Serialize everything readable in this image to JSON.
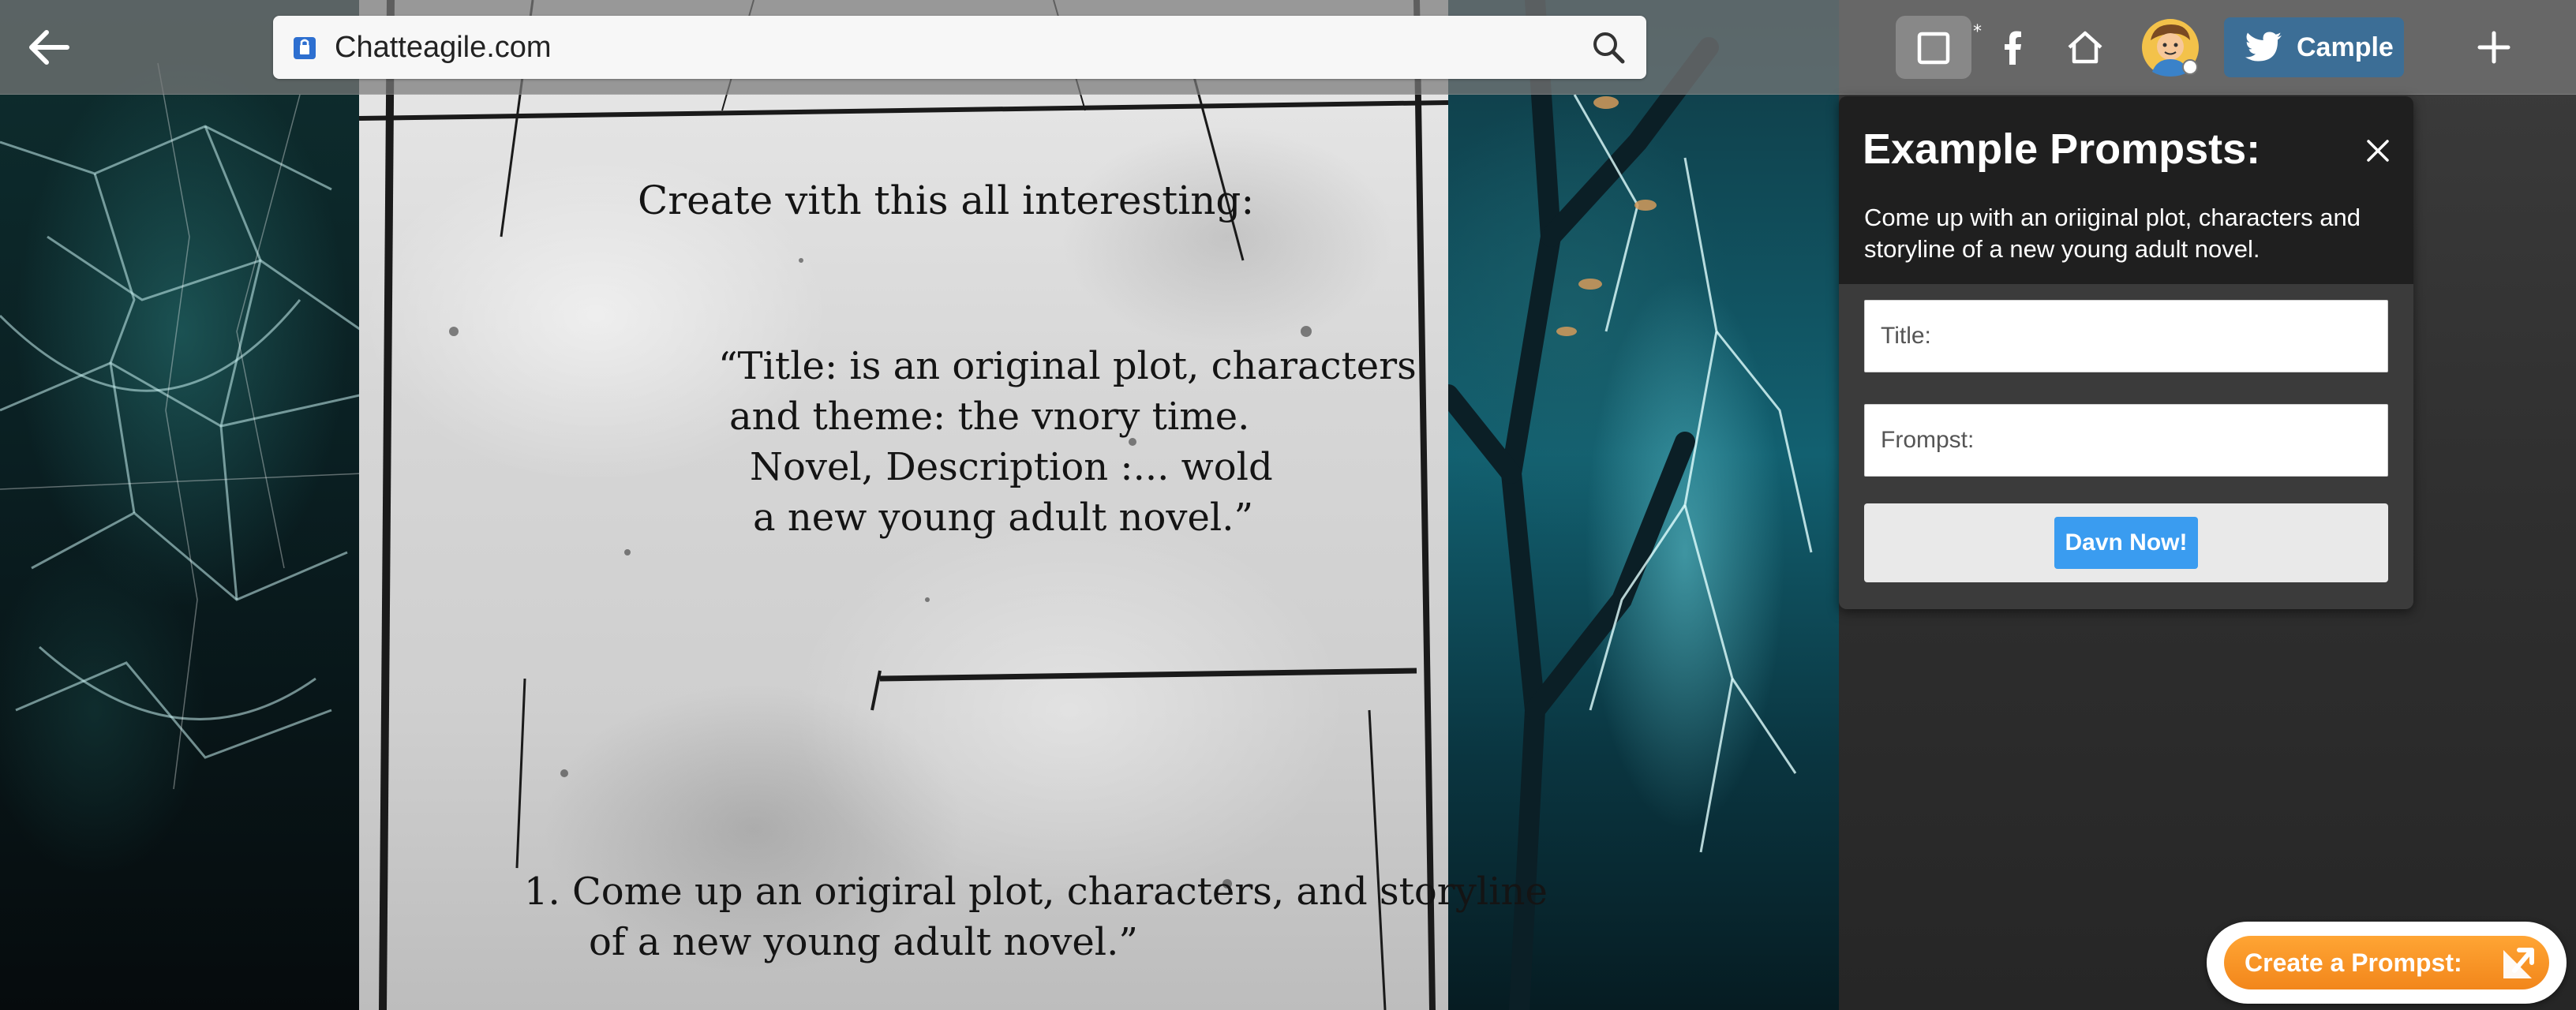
{
  "browser": {
    "url": "Chatteagile.com",
    "twitter_label": "Cample",
    "tabs_marker": "*",
    "icons": {
      "back": "arrow-left-icon",
      "lock": "site-lock-icon",
      "search": "search-icon",
      "tabs": "tabs-square-icon",
      "facebook": "facebook-icon",
      "home": "home-icon",
      "avatar": "user-avatar-icon",
      "twitter": "twitter-bird-icon",
      "new_tab": "plus-icon"
    }
  },
  "page": {
    "heading": "Create vith this all interesting:",
    "quote_lines": [
      "“Title:  is an original plot, characters",
      "and theme: the vnory time.",
      "Novel, Description :... wold",
      "a new young adult novel.”"
    ],
    "list_lines": [
      "1. Come up an origiral plot, characters, and storyline",
      "of a new young adult novel.”"
    ]
  },
  "panel": {
    "title": "Example Prompsts:",
    "description": "Come up with an oriiginal plot, characters and storyline of a new young adult novel.",
    "title_placeholder": "Title:",
    "prompt_placeholder": "Frompst:",
    "submit_label": "Davn Now!"
  },
  "fab": {
    "label": "Create a Prompst:"
  },
  "colors": {
    "topbar": "#7a7a7a",
    "twitter_button": "#3c6e96",
    "submit_button": "#3a9cf0",
    "create_button": "#f2861b",
    "panel_header": "#1f1f1f"
  }
}
